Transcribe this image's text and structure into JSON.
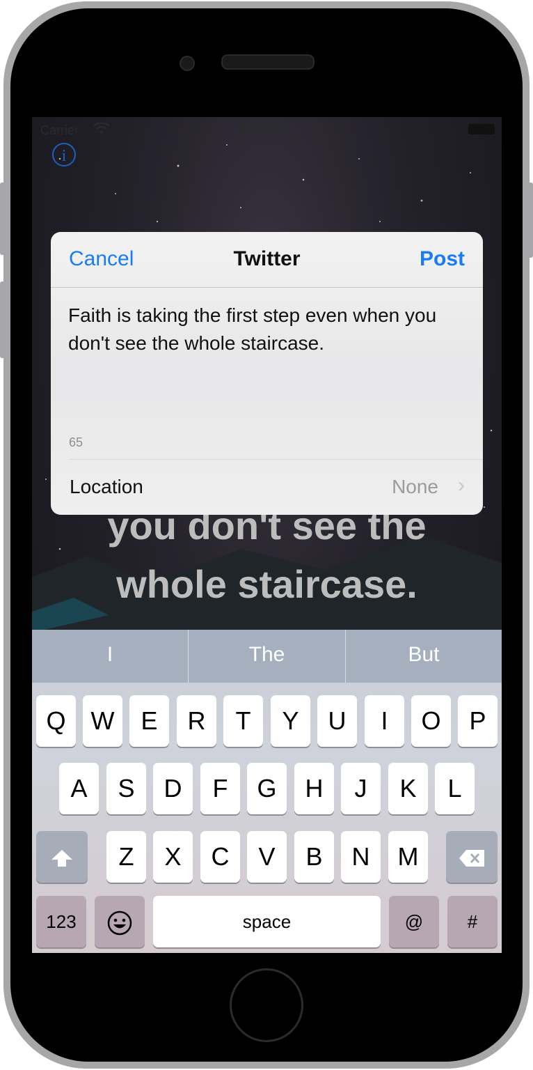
{
  "status_bar": {
    "carrier": "Carrier",
    "time": "9:18 AM"
  },
  "background_quote": {
    "line1": "you don't see the",
    "line2": "whole staircase."
  },
  "twitter_sheet": {
    "cancel_label": "Cancel",
    "title": "Twitter",
    "post_label": "Post",
    "tweet_text": "Faith is taking the first step even when you don't see the whole staircase.",
    "char_count": "65",
    "location_label": "Location",
    "location_value": "None"
  },
  "keyboard": {
    "predictions": [
      "I",
      "The",
      "But"
    ],
    "row1": [
      "Q",
      "W",
      "E",
      "R",
      "T",
      "Y",
      "U",
      "I",
      "O",
      "P"
    ],
    "row2": [
      "A",
      "S",
      "D",
      "F",
      "G",
      "H",
      "J",
      "K",
      "L"
    ],
    "row3": [
      "Z",
      "X",
      "C",
      "V",
      "B",
      "N",
      "M"
    ],
    "numbers_label": "123",
    "space_label": "space",
    "at_label": "@",
    "hash_label": "#"
  },
  "colors": {
    "ios_blue": "#1a7cf4",
    "info_blue": "#1f5fbf",
    "predictive_bar": "#a5afbe"
  }
}
